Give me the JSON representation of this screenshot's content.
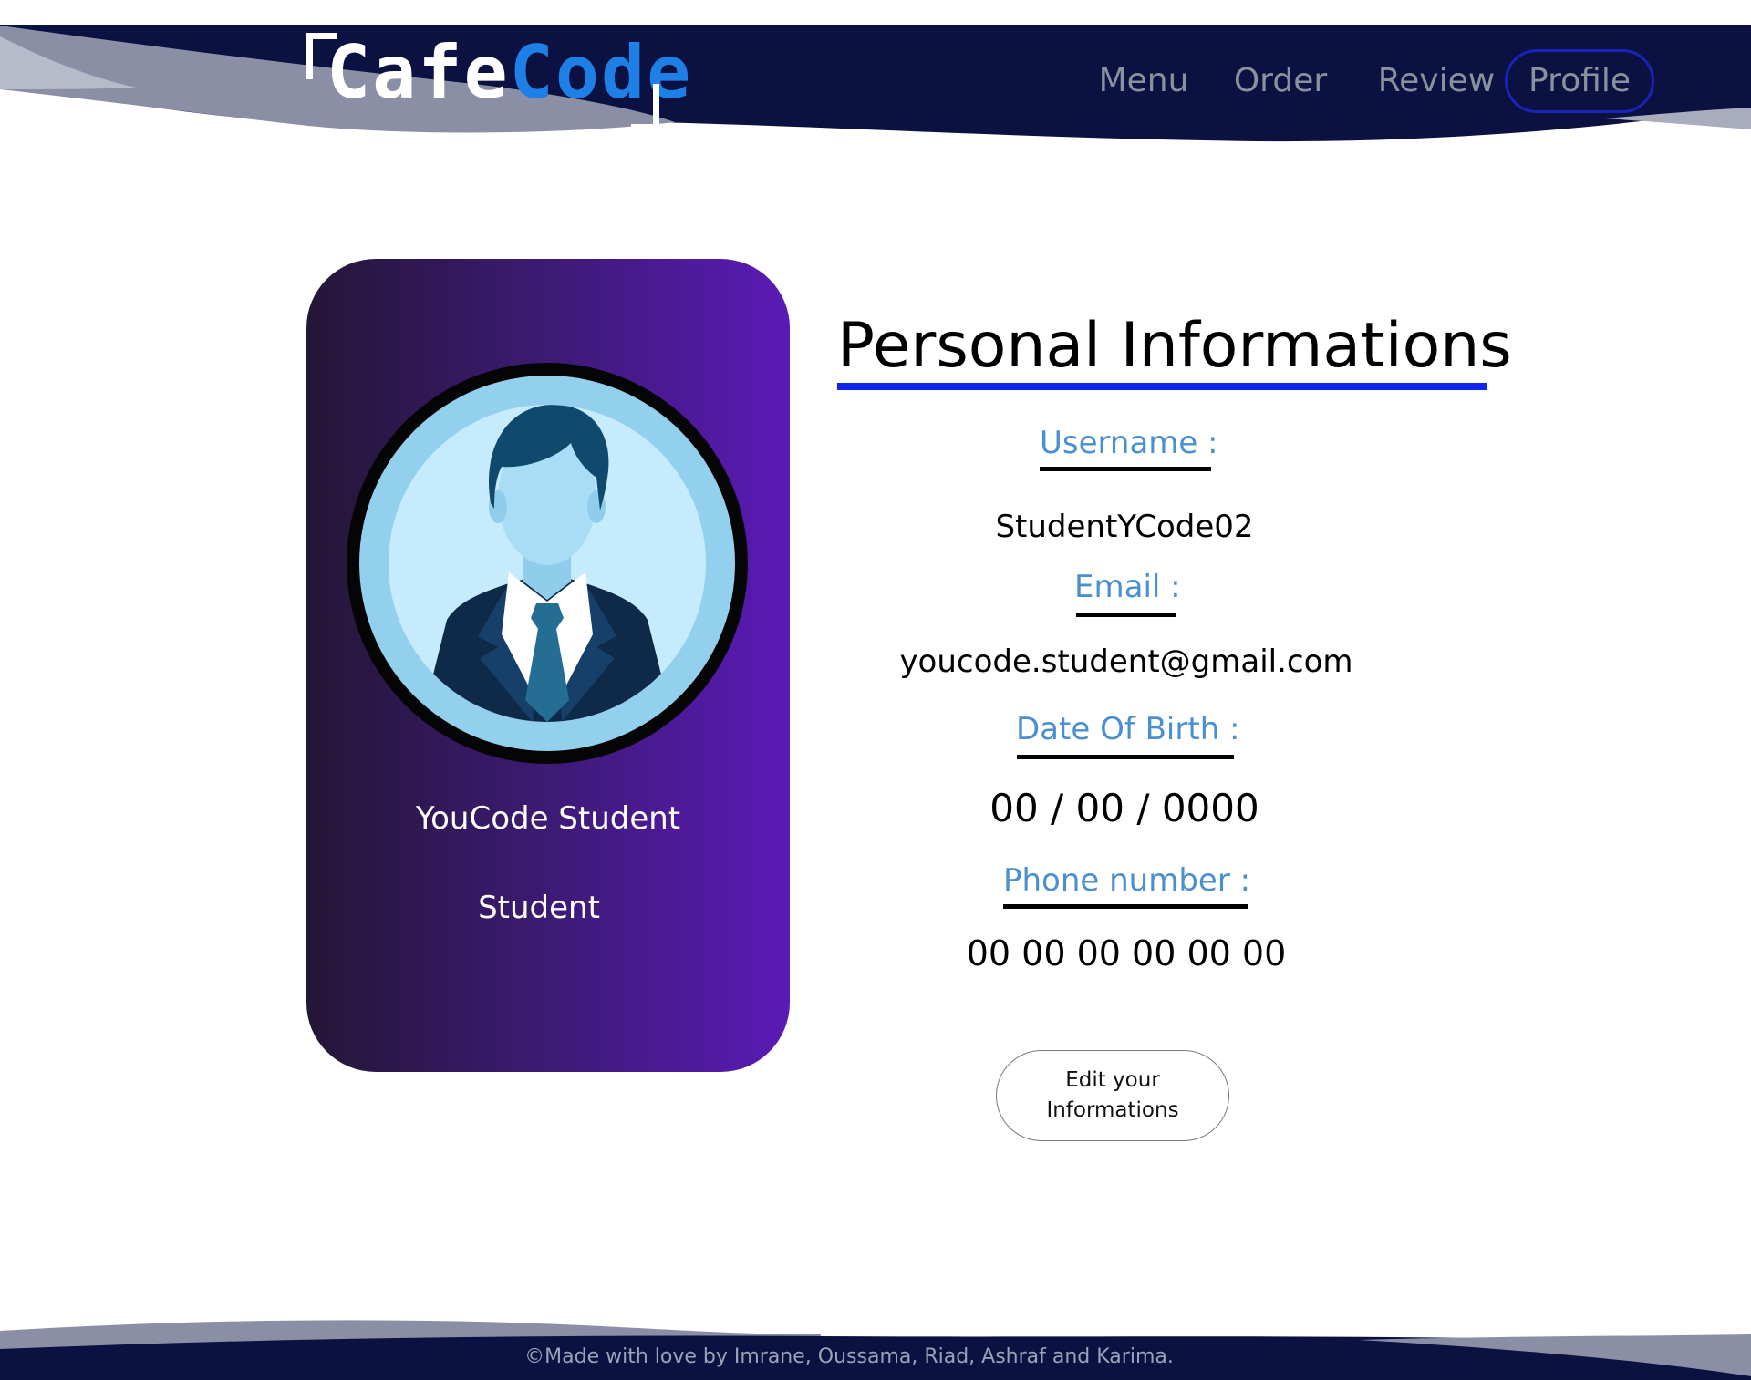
{
  "header": {
    "logo": {
      "word_1": "Cafe",
      "word_2": "Code"
    },
    "nav": {
      "menu": "Menu",
      "order": "Order",
      "review": "Review",
      "profile": "Profile",
      "active": "profile"
    }
  },
  "profile_card": {
    "name": "YouCode Student",
    "role": "Student",
    "avatar_icon": "user-avatar-icon"
  },
  "info": {
    "title": "Personal Informations",
    "fields": {
      "username": {
        "label": "Username :",
        "value": "StudentYCode02"
      },
      "email": {
        "label": "Email :",
        "value": "youcode.student@gmail.com"
      },
      "dob": {
        "label": "Date Of Birth :",
        "value": "00 / 00 / 0000"
      },
      "phone": {
        "label": "Phone number :",
        "value": "00 00 00 00 00 00"
      }
    },
    "edit_button": "Edit your Informations"
  },
  "footer": {
    "text": "©Made with love by Imrane, Oussama, Riad, Ashraf and Karima."
  },
  "colors": {
    "header_navy": "#0b1140",
    "wave_grey": "#8a8fa6",
    "logo_accent": "#1e7fe6",
    "profile_pill_border": "#1b22b8",
    "title_underline": "#1126ec",
    "label_blue": "#4a8fd0",
    "card_gradient_start": "#241636",
    "card_gradient_end": "#5a1ab6"
  }
}
